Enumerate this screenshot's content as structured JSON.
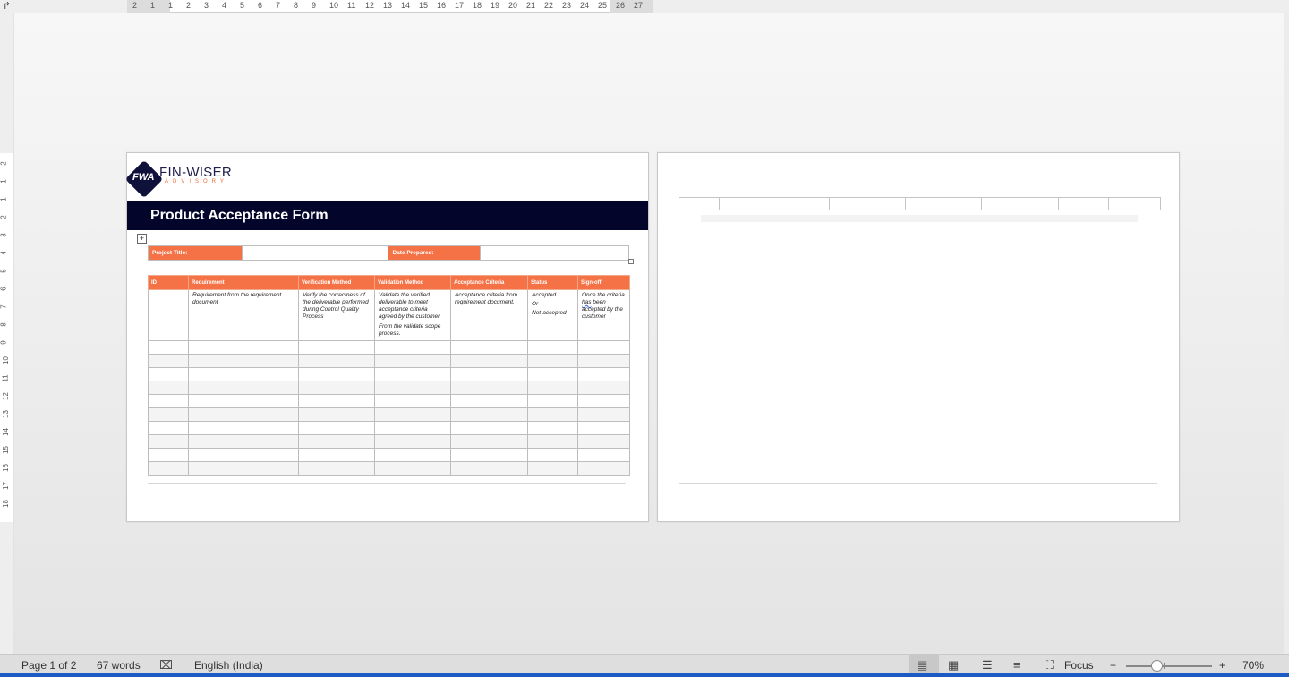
{
  "ruler": {
    "h_numbers": [
      "2",
      "1",
      "1",
      "2",
      "3",
      "4",
      "5",
      "6",
      "7",
      "8",
      "9",
      "10",
      "11",
      "12",
      "13",
      "14",
      "15",
      "16",
      "17",
      "18",
      "19",
      "20",
      "21",
      "22",
      "23",
      "24",
      "25",
      "26",
      "27"
    ],
    "v_numbers": [
      "2",
      "1",
      "1",
      "2",
      "3",
      "4",
      "5",
      "6",
      "7",
      "8",
      "9",
      "10",
      "11",
      "12",
      "13",
      "14",
      "15",
      "16",
      "17",
      "18"
    ]
  },
  "document": {
    "logo": {
      "mark_text": "FWA",
      "brand": "FIN-WISER",
      "subtitle": "ADVISORY"
    },
    "form_title": "Product Acceptance Form",
    "table_move_glyph": "+",
    "info_row": {
      "project_title_label": "Project Title:",
      "project_title_value": "",
      "date_prepared_label": "Date Prepared:",
      "date_prepared_value": ""
    },
    "columns": [
      "ID",
      "Requirement",
      "Verification Method",
      "Validation Method",
      "Acceptance Criteria",
      "Status",
      "Sign-off"
    ],
    "example_row": {
      "id": "",
      "requirement": "Requirement from the requirement document",
      "verification": "Verify the correctness of the deliverable performed during Control Quality Process",
      "validation_1": "Validate the verified deliverable to meet acceptance criteria agreed by the customer.",
      "validation_2": "From the validate scope process.",
      "acceptance": "Acceptance criteria from requirement document.",
      "status_1": "Accepted",
      "status_2": "Or",
      "status_3": "Not-accepted",
      "signoff_pre": "Once the criteria ",
      "signoff_word": "has",
      "signoff_post": " been accepted by the customer"
    },
    "blank_rows": 10
  },
  "statusbar": {
    "page": "Page 1 of 2",
    "words": "67 words",
    "language": "English (India)",
    "focus": "Focus",
    "zoom_minus": "−",
    "zoom_plus": "+",
    "zoom": "70%",
    "zoom_fraction": 0.35
  }
}
